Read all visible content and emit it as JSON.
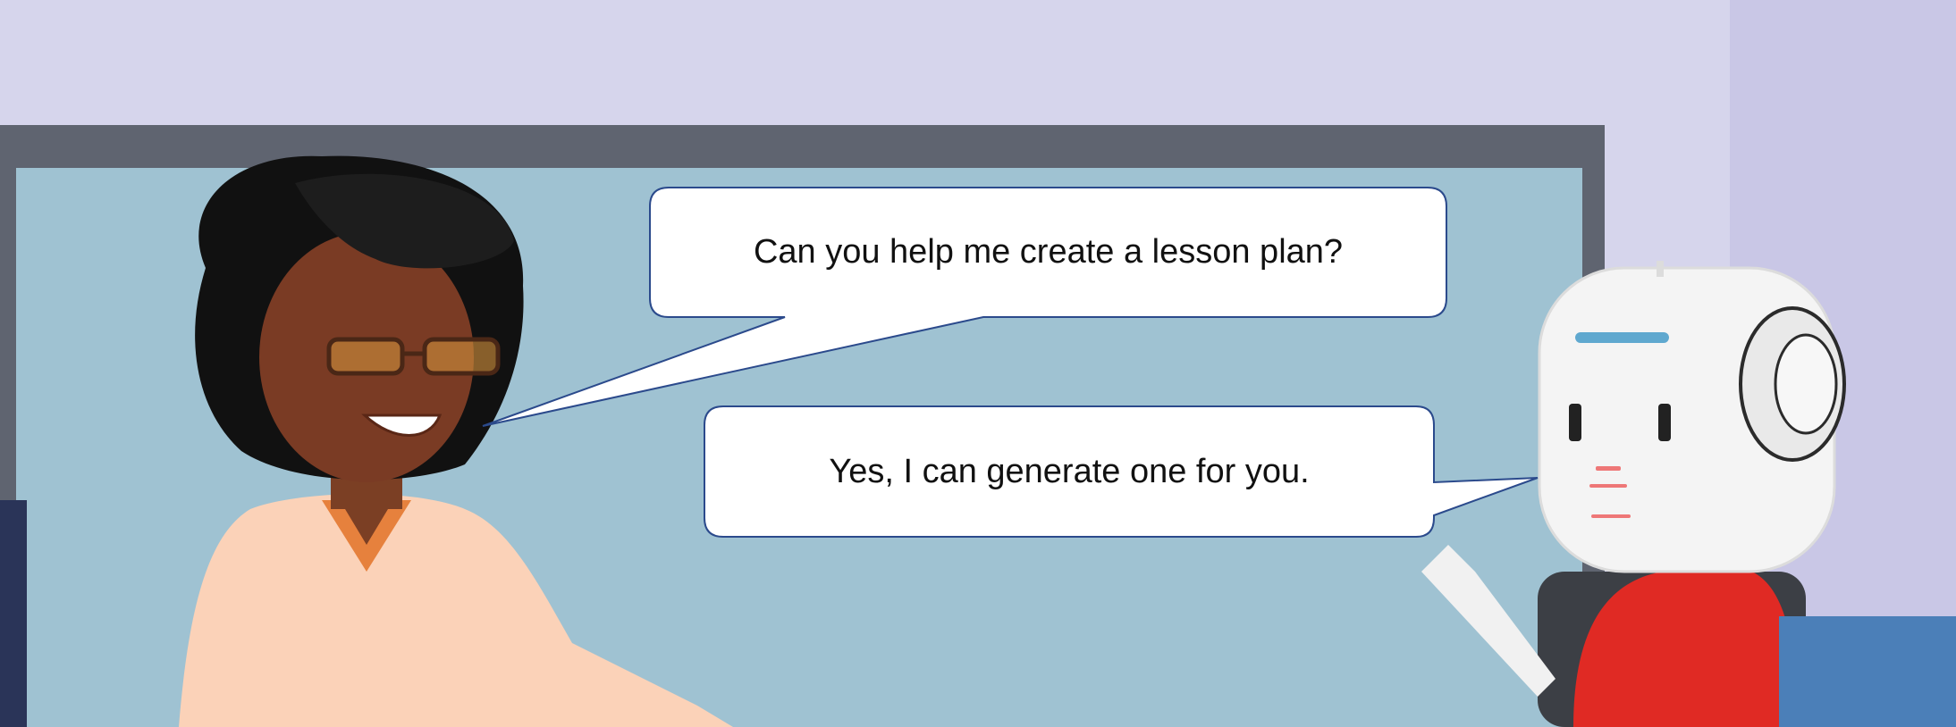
{
  "dialogue": {
    "human_line": "Can you help me create a lesson plan?",
    "robot_line": "Yes, I can generate one for you."
  },
  "colors": {
    "wall": "#d6d5ec",
    "board_frame": "#5f6470",
    "board_surface": "#9fc2d2",
    "bubble_border": "#2b4a8c",
    "robot_shirt": "#e02a24"
  },
  "icons": {
    "woman": "teacher-character",
    "robot": "robot-character"
  }
}
